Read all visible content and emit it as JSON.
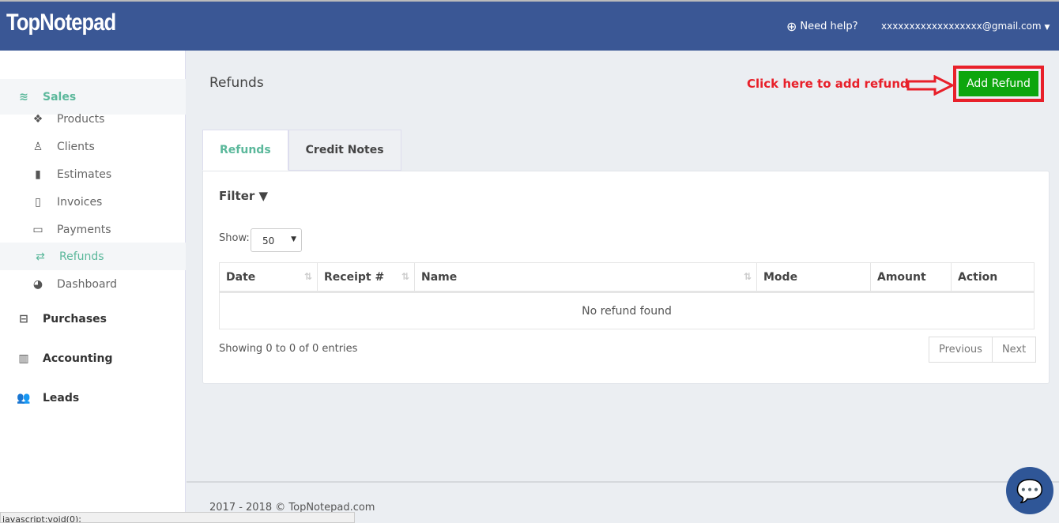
{
  "header": {
    "logo": "TopNotepad",
    "help": "Need help?",
    "user": "xxxxxxxxxxxxxxxxxx@gmail.com"
  },
  "sidebar": {
    "items": [
      {
        "label": "Sales",
        "icon": "layers-icon",
        "group": true,
        "active": true
      },
      {
        "label": "Products",
        "icon": "cubes-icon"
      },
      {
        "label": "Clients",
        "icon": "user-icon"
      },
      {
        "label": "Estimates",
        "icon": "file-icon"
      },
      {
        "label": "Invoices",
        "icon": "file-outline-icon"
      },
      {
        "label": "Payments",
        "icon": "credit-card-icon"
      },
      {
        "label": "Refunds",
        "icon": "exchange-icon",
        "active": true
      },
      {
        "label": "Dashboard",
        "icon": "dashboard-icon"
      },
      {
        "label": "Purchases",
        "icon": "minus-square-icon",
        "group": true
      },
      {
        "label": "Accounting",
        "icon": "bar-chart-icon",
        "group": true
      },
      {
        "label": "Leads",
        "icon": "users-icon",
        "group": true
      }
    ]
  },
  "page": {
    "title": "Refunds",
    "hint": "Click here to add refund",
    "add_button": "Add Refund"
  },
  "tabs": [
    "Refunds",
    "Credit Notes"
  ],
  "filter": {
    "label": "Filter",
    "show_label": "Show:",
    "page_size": "50"
  },
  "table": {
    "columns": [
      "Date",
      "Receipt #",
      "Name",
      "Mode",
      "Amount",
      "Action"
    ],
    "empty": "No refund found"
  },
  "pagination": {
    "info": "Showing 0 to 0 of 0 entries",
    "previous": "Previous",
    "next": "Next"
  },
  "footer": "2017 - 2018 © TopNotepad.com",
  "status_bar": "javascript:void(0);",
  "colors": {
    "header": "#3a5795",
    "accent": "#5bb89b",
    "add_button": "#0da60d",
    "annotation": "#e8202a"
  }
}
